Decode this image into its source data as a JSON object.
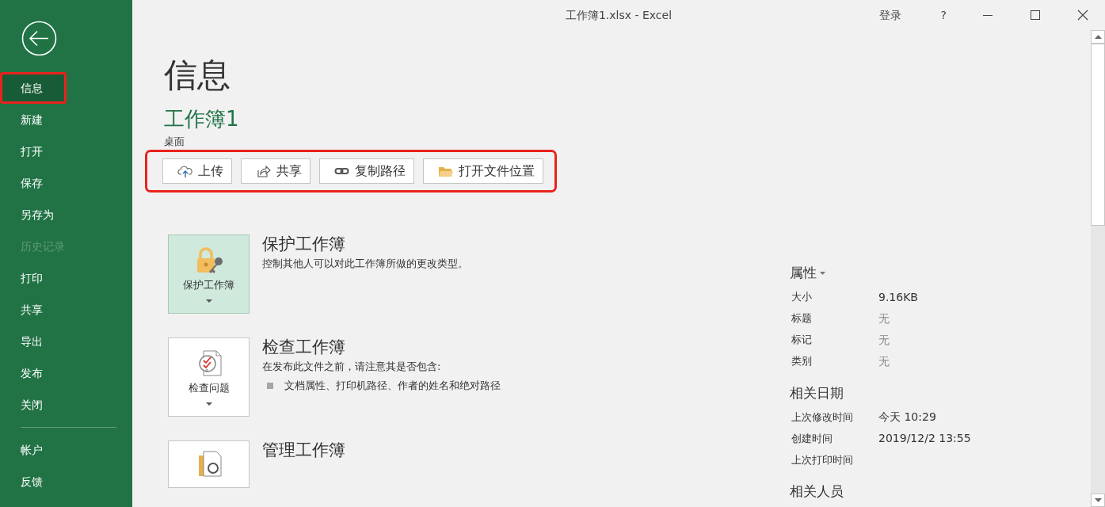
{
  "window": {
    "title": "工作簿1.xlsx  -  Excel",
    "sign_in": "登录",
    "help": "?"
  },
  "sidebar": {
    "items": [
      {
        "label": "信息",
        "selected": true,
        "disabled": false,
        "highlighted": true
      },
      {
        "label": "新建",
        "selected": false,
        "disabled": false,
        "highlighted": false
      },
      {
        "label": "打开",
        "selected": false,
        "disabled": false,
        "highlighted": false
      },
      {
        "label": "保存",
        "selected": false,
        "disabled": false,
        "highlighted": false
      },
      {
        "label": "另存为",
        "selected": false,
        "disabled": false,
        "highlighted": false
      },
      {
        "label": "历史记录",
        "selected": false,
        "disabled": true,
        "highlighted": false
      },
      {
        "label": "打印",
        "selected": false,
        "disabled": false,
        "highlighted": false
      },
      {
        "label": "共享",
        "selected": false,
        "disabled": false,
        "highlighted": false
      },
      {
        "label": "导出",
        "selected": false,
        "disabled": false,
        "highlighted": false
      },
      {
        "label": "发布",
        "selected": false,
        "disabled": false,
        "highlighted": false
      },
      {
        "label": "关闭",
        "selected": false,
        "disabled": false,
        "highlighted": false
      }
    ],
    "bottom_items": [
      {
        "label": "帐户",
        "selected": false,
        "disabled": false,
        "highlighted": false
      },
      {
        "label": "反馈",
        "selected": false,
        "disabled": false,
        "highlighted": false
      }
    ]
  },
  "page": {
    "heading": "信息",
    "file_name": "工作簿1",
    "location": "桌面",
    "actions_highlighted": true,
    "actions": [
      {
        "kind": "upload",
        "label": "上传"
      },
      {
        "kind": "share",
        "label": "共享"
      },
      {
        "kind": "link",
        "label": "复制路径"
      },
      {
        "kind": "folder",
        "label": "打开文件位置"
      }
    ]
  },
  "sections": [
    {
      "kind": "protect",
      "tile_label": "保护工作簿",
      "tile_selected": true,
      "title": "保护工作簿",
      "description": "控制其他人可以对此工作簿所做的更改类型。"
    },
    {
      "kind": "inspect",
      "tile_label": "检查问题",
      "tile_selected": false,
      "title": "检查工作簿",
      "description": "在发布此文件之前，请注意其是否包含:",
      "bullets": [
        "文档属性、打印机路径、作者的姓名和绝对路径"
      ]
    },
    {
      "kind": "manage",
      "tile_selected": false,
      "title": "管理工作簿"
    }
  ],
  "properties": {
    "heading": "属性",
    "rows": [
      {
        "label": "大小",
        "value": "9.16KB",
        "muted": false
      },
      {
        "label": "标题",
        "value": "无",
        "muted": true
      },
      {
        "label": "标记",
        "value": "无",
        "muted": true
      },
      {
        "label": "类别",
        "value": "无",
        "muted": true
      }
    ]
  },
  "dates": {
    "heading": "相关日期",
    "rows": [
      {
        "label": "上次修改时间",
        "value": "今天 10:29",
        "muted": false
      },
      {
        "label": "创建时间",
        "value": "2019/12/2 13:55",
        "muted": false
      },
      {
        "label": "上次打印时间"
      }
    ]
  },
  "people": {
    "heading": "相关人员"
  }
}
